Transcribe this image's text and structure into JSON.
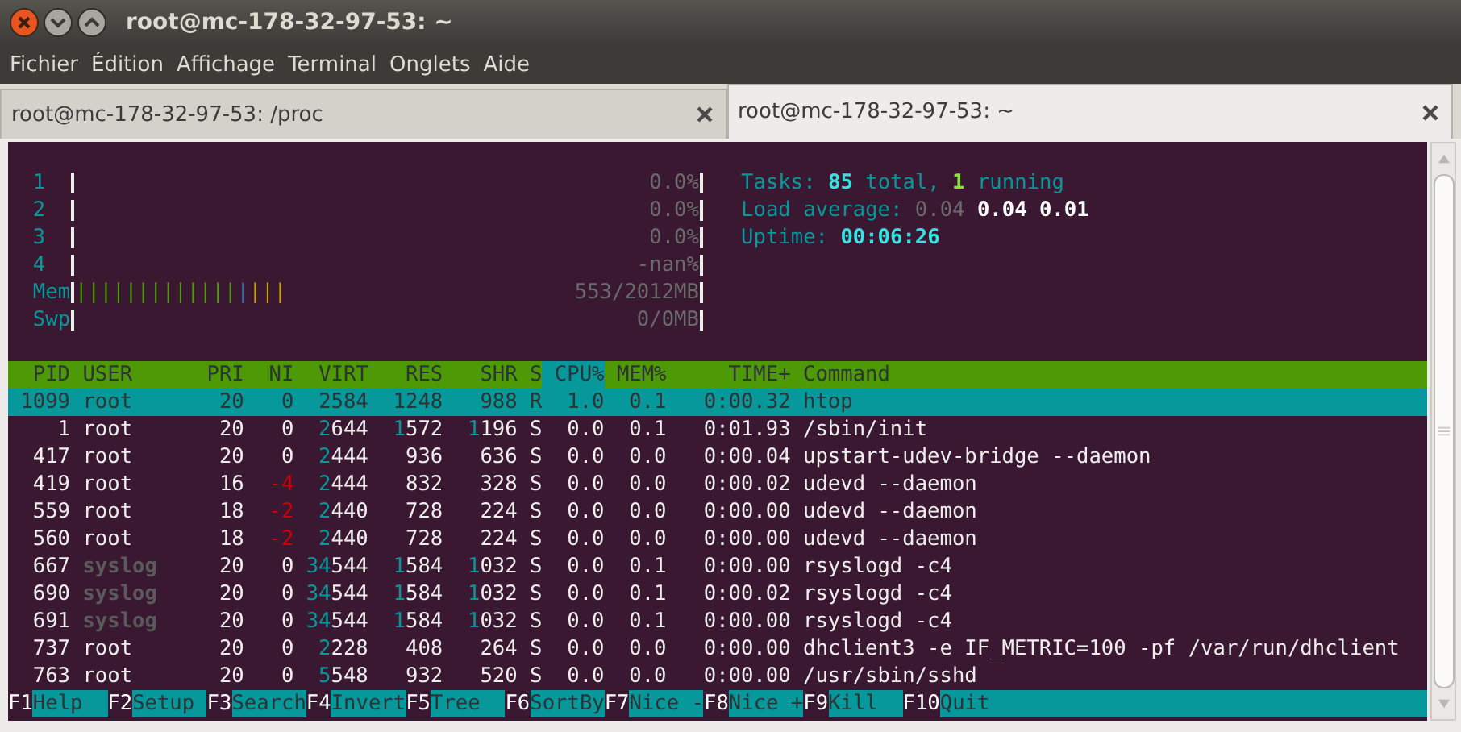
{
  "window": {
    "title": "root@mc-178-32-97-53: ~"
  },
  "menu": [
    "Fichier",
    "Édition",
    "Affichage",
    "Terminal",
    "Onglets",
    "Aide"
  ],
  "tabs": [
    {
      "label": "root@mc-178-32-97-53: /proc",
      "selected": false
    },
    {
      "label": "root@mc-178-32-97-53: ~",
      "selected": true
    }
  ],
  "meters": [
    {
      "label": "1",
      "value": "0.0%"
    },
    {
      "label": "2",
      "value": "0.0%"
    },
    {
      "label": "3",
      "value": "0.0%"
    },
    {
      "label": "4",
      "value": "-nan%"
    },
    {
      "label": "Mem",
      "bars": [
        {
          "text": "|||||||||||||",
          "color": "#4e9a06"
        },
        {
          "text": "|",
          "color": "#3465a4"
        },
        {
          "text": "|||",
          "color": "#c4a000"
        }
      ],
      "value": "553/2012MB"
    },
    {
      "label": "Swp",
      "value": "0/0MB"
    }
  ],
  "info": [
    {
      "parts": [
        {
          "text": "Tasks: ",
          "kind": "label"
        },
        {
          "text": "85",
          "kind": "value"
        },
        {
          "text": " total, ",
          "kind": "label"
        },
        {
          "text": "1",
          "kind": "running"
        },
        {
          "text": " running",
          "kind": "label"
        }
      ]
    },
    {
      "parts": [
        {
          "text": "Load average: ",
          "kind": "label"
        },
        {
          "text": "0.04",
          "kind": "dim"
        },
        {
          "text": "0.04 0.01",
          "kind": "strong"
        }
      ]
    },
    {
      "parts": [
        {
          "text": "Uptime: ",
          "kind": "label"
        },
        {
          "text": "00:06:26",
          "kind": "value"
        }
      ]
    }
  ],
  "columns": [
    {
      "label": "PID",
      "sorted": false
    },
    {
      "label": "USER",
      "sorted": false
    },
    {
      "label": "PRI",
      "sorted": false
    },
    {
      "label": "NI",
      "sorted": false
    },
    {
      "label": "VIRT",
      "sorted": false
    },
    {
      "label": "RES",
      "sorted": false
    },
    {
      "label": "SHR",
      "sorted": false
    },
    {
      "label": "S",
      "sorted": false
    },
    {
      "label": "CPU%",
      "sorted": true
    },
    {
      "label": "MEM%",
      "sorted": false
    },
    {
      "label": "TIME+",
      "sorted": false
    },
    {
      "label": "Command",
      "sorted": false
    }
  ],
  "rows": [
    {
      "pid": "1099",
      "user": "root",
      "pri": "20",
      "ni": "0",
      "virt": "2584",
      "res": "1248",
      "shr": "988",
      "s": "R",
      "cpu": "1.0",
      "mem": "0.1",
      "time": "0:00.32",
      "command": "htop",
      "selected": true,
      "dimmed": false
    },
    {
      "pid": "1",
      "user": "root",
      "pri": "20",
      "ni": "0",
      "virt": "2644",
      "res": "1572",
      "shr": "1196",
      "s": "S",
      "cpu": "0.0",
      "mem": "0.1",
      "time": "0:01.93",
      "command": "/sbin/init",
      "selected": false,
      "dimmed": false
    },
    {
      "pid": "417",
      "user": "root",
      "pri": "20",
      "ni": "0",
      "virt": "2444",
      "res": "936",
      "shr": "636",
      "s": "S",
      "cpu": "0.0",
      "mem": "0.0",
      "time": "0:00.04",
      "command": "upstart-udev-bridge --daemon",
      "selected": false,
      "dimmed": false
    },
    {
      "pid": "419",
      "user": "root",
      "pri": "16",
      "ni": "-4",
      "virt": "2444",
      "res": "832",
      "shr": "328",
      "s": "S",
      "cpu": "0.0",
      "mem": "0.0",
      "time": "0:00.02",
      "command": "udevd --daemon",
      "selected": false,
      "dimmed": false
    },
    {
      "pid": "559",
      "user": "root",
      "pri": "18",
      "ni": "-2",
      "virt": "2440",
      "res": "728",
      "shr": "224",
      "s": "S",
      "cpu": "0.0",
      "mem": "0.0",
      "time": "0:00.00",
      "command": "udevd --daemon",
      "selected": false,
      "dimmed": false
    },
    {
      "pid": "560",
      "user": "root",
      "pri": "18",
      "ni": "-2",
      "virt": "2440",
      "res": "728",
      "shr": "224",
      "s": "S",
      "cpu": "0.0",
      "mem": "0.0",
      "time": "0:00.00",
      "command": "udevd --daemon",
      "selected": false,
      "dimmed": false
    },
    {
      "pid": "667",
      "user": "syslog",
      "pri": "20",
      "ni": "0",
      "virt": "34544",
      "res": "1584",
      "shr": "1032",
      "s": "S",
      "cpu": "0.0",
      "mem": "0.1",
      "time": "0:00.00",
      "command": "rsyslogd -c4",
      "selected": false,
      "dimmed": true
    },
    {
      "pid": "690",
      "user": "syslog",
      "pri": "20",
      "ni": "0",
      "virt": "34544",
      "res": "1584",
      "shr": "1032",
      "s": "S",
      "cpu": "0.0",
      "mem": "0.1",
      "time": "0:00.02",
      "command": "rsyslogd -c4",
      "selected": false,
      "dimmed": true
    },
    {
      "pid": "691",
      "user": "syslog",
      "pri": "20",
      "ni": "0",
      "virt": "34544",
      "res": "1584",
      "shr": "1032",
      "s": "S",
      "cpu": "0.0",
      "mem": "0.1",
      "time": "0:00.00",
      "command": "rsyslogd -c4",
      "selected": false,
      "dimmed": true
    },
    {
      "pid": "737",
      "user": "root",
      "pri": "20",
      "ni": "0",
      "virt": "2228",
      "res": "408",
      "shr": "264",
      "s": "S",
      "cpu": "0.0",
      "mem": "0.0",
      "time": "0:00.00",
      "command": "dhclient3 -e IF_METRIC=100 -pf /var/run/dhclient",
      "selected": false,
      "dimmed": false
    },
    {
      "pid": "763",
      "user": "root",
      "pri": "20",
      "ni": "0",
      "virt": "5548",
      "res": "932",
      "shr": "520",
      "s": "S",
      "cpu": "0.0",
      "mem": "0.0",
      "time": "0:00.00",
      "command": "/usr/sbin/sshd",
      "selected": false,
      "dimmed": false
    }
  ],
  "function_keys": [
    {
      "key": "F1",
      "label": "Help"
    },
    {
      "key": "F2",
      "label": "Setup"
    },
    {
      "key": "F3",
      "label": "Search"
    },
    {
      "key": "F4",
      "label": "Invert"
    },
    {
      "key": "F5",
      "label": "Tree"
    },
    {
      "key": "F6",
      "label": "SortBy"
    },
    {
      "key": "F7",
      "label": "Nice -"
    },
    {
      "key": "F8",
      "label": "Nice +"
    },
    {
      "key": "F9",
      "label": "Kill"
    },
    {
      "key": "F10",
      "label": "Quit"
    }
  ]
}
